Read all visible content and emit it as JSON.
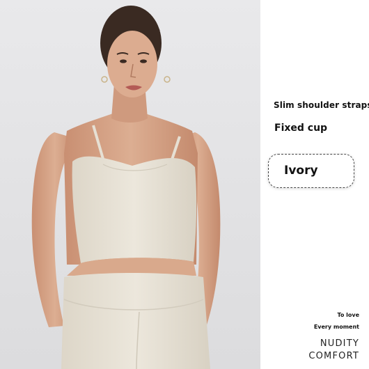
{
  "product": {
    "features": [
      "Slim shoulder straps",
      "Fixed cup"
    ],
    "selected_color": "Ivory",
    "tagline": [
      "To love",
      "Every moment"
    ],
    "brand": [
      "NUDITY",
      "COMFORT"
    ]
  },
  "colors": {
    "background": "#e8e8ea",
    "garment": "#e8e2d6",
    "skin": "#d9a98c",
    "hair": "#3a2a22"
  }
}
